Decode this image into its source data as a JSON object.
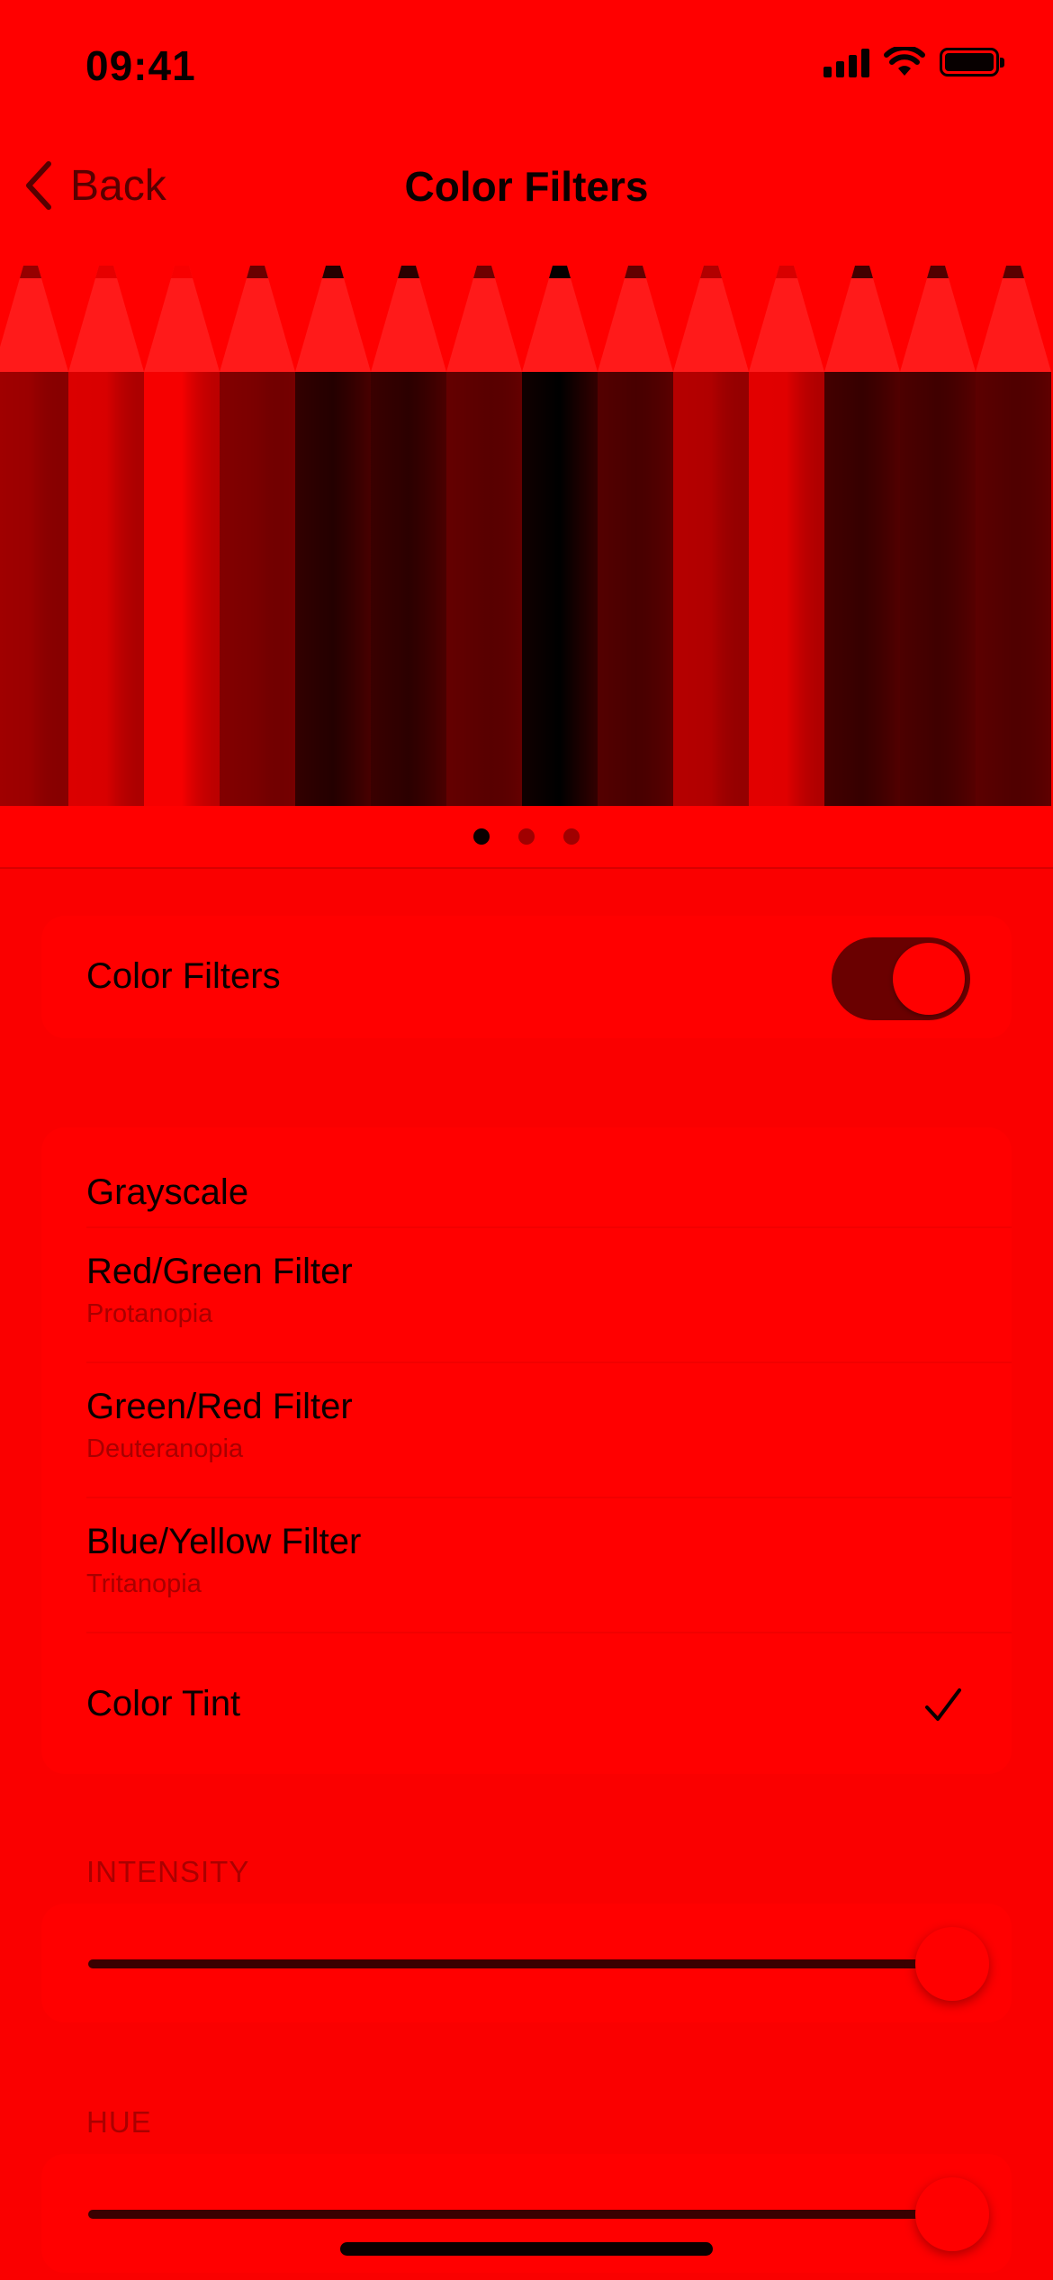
{
  "status_bar": {
    "time": "09:41",
    "icons": [
      "cellular-signal-icon",
      "wifi-icon",
      "battery-icon"
    ]
  },
  "nav": {
    "back_label": "Back",
    "title": "Color Filters"
  },
  "hero": {
    "description_icon": "colored-pencils-illustration",
    "page_count": 3,
    "current_page": 1
  },
  "color_filters_toggle": {
    "label": "Color Filters",
    "enabled": true
  },
  "filters": [
    {
      "label": "Grayscale",
      "sublabel": "",
      "selected": false
    },
    {
      "label": "Red/Green Filter",
      "sublabel": "Protanopia",
      "selected": false
    },
    {
      "label": "Green/Red Filter",
      "sublabel": "Deuteranopia",
      "selected": false
    },
    {
      "label": "Blue/Yellow Filter",
      "sublabel": "Tritanopia",
      "selected": false
    },
    {
      "label": "Color Tint",
      "sublabel": "",
      "selected": true
    }
  ],
  "intensity": {
    "header": "INTENSITY",
    "value": 1.0
  },
  "hue": {
    "header": "HUE",
    "value": 1.0
  },
  "colors": {
    "tint": "#ff0000",
    "toggle_on": "#6a0000",
    "text": "#0a0000",
    "secondary_text": "#a80000"
  }
}
